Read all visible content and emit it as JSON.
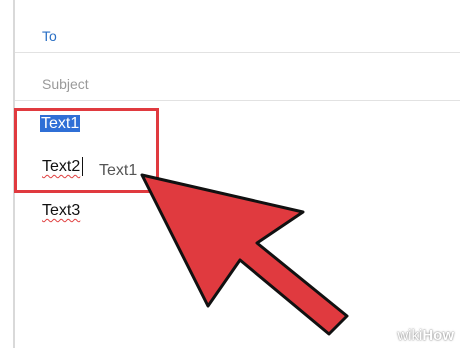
{
  "compose": {
    "to_label": "To",
    "subject_placeholder": "Subject",
    "lines": [
      "Text1",
      "Text2",
      "Text3"
    ],
    "drag_ghost_text": "Text1"
  },
  "watermark": {
    "prefix": "wiki",
    "suffix": "How"
  },
  "colors": {
    "highlight": "#e03a3f",
    "arrow_fill": "#e03a3f",
    "selection": "#2f6fd6",
    "link_blue": "#2a6fc4"
  }
}
